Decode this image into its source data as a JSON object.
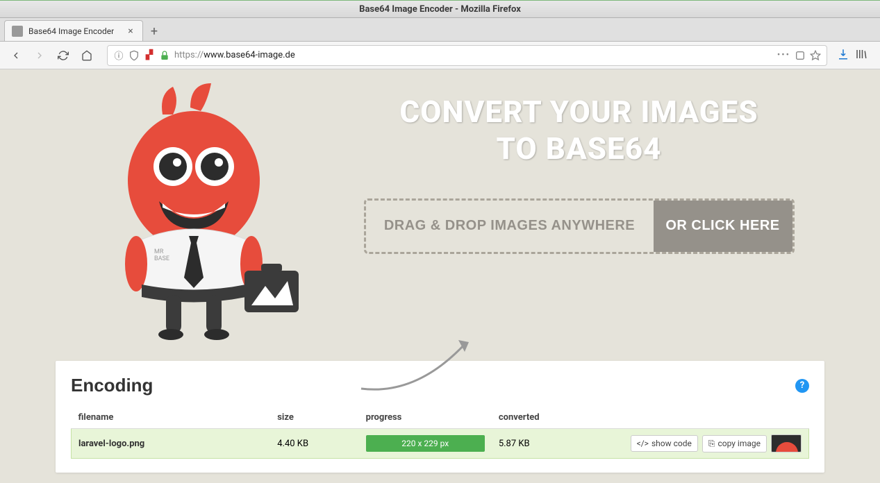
{
  "window": {
    "title": "Base64 Image Encoder - Mozilla Firefox"
  },
  "tab": {
    "title": "Base64 Image Encoder"
  },
  "url": {
    "prefix": "https://",
    "rest": "www.base64-image.de"
  },
  "hero": {
    "line1": "CONVERT YOUR IMAGES",
    "line2": "TO BASE64",
    "dropText": "DRAG & DROP IMAGES ANYWHERE",
    "clickText": "OR CLICK HERE",
    "mascotLabel1": "MR",
    "mascotLabel2": "BASE"
  },
  "panel": {
    "title": "Encoding",
    "cols": {
      "filename": "filename",
      "size": "size",
      "progress": "progress",
      "converted": "converted"
    },
    "row": {
      "filename": "laravel-logo.png",
      "size": "4.40 KB",
      "progress": "220 x 229 px",
      "converted": "5.87 KB",
      "showCode": "show code",
      "copyImage": "copy image"
    }
  }
}
